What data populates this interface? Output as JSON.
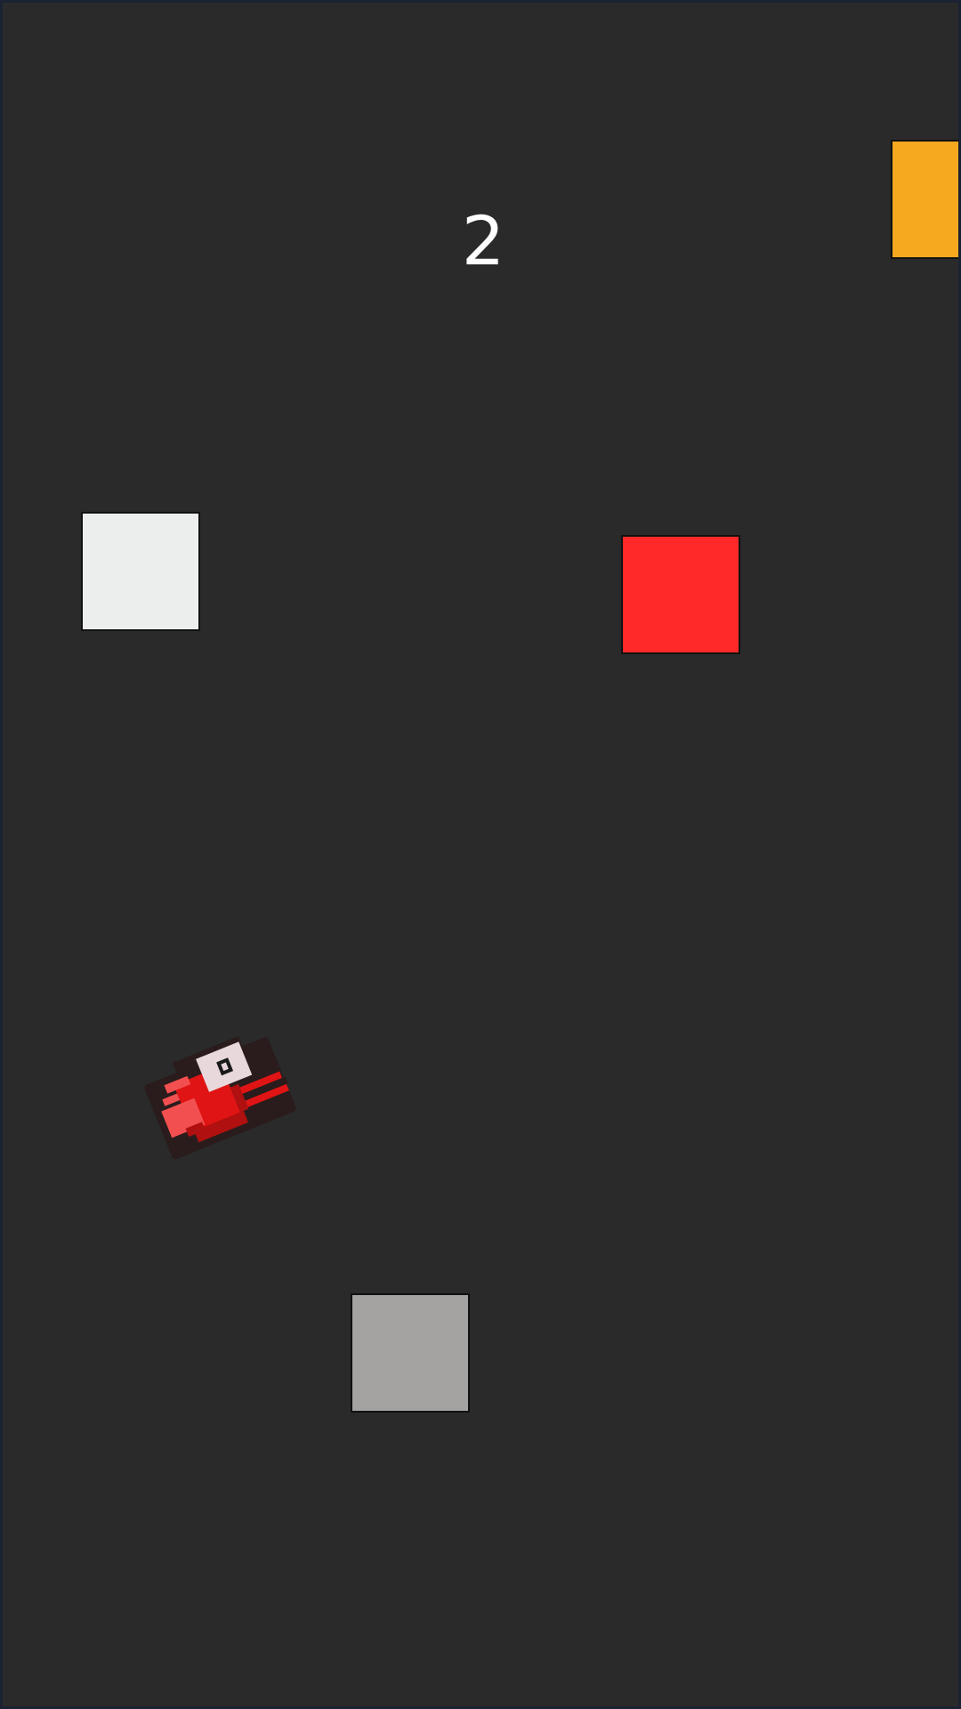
{
  "game": {
    "score": "2",
    "background_color": "#2a2a2a",
    "score_color": "#ffffff",
    "player": {
      "character": "red-pixel-bird",
      "icon": "bird-icon",
      "colors": {
        "outline": "#2a1c1c",
        "body_light": "#f25050",
        "body": "#e01414",
        "body_dark": "#b01010",
        "eye_white": "#e8d8dc",
        "pupil": "#1a1a1a"
      }
    },
    "blocks": [
      {
        "id": "orange",
        "color": "#f6a91f"
      },
      {
        "id": "white",
        "color": "#eceeed"
      },
      {
        "id": "red",
        "color": "#ff2929"
      },
      {
        "id": "gray",
        "color": "#a5a3a1"
      }
    ]
  }
}
